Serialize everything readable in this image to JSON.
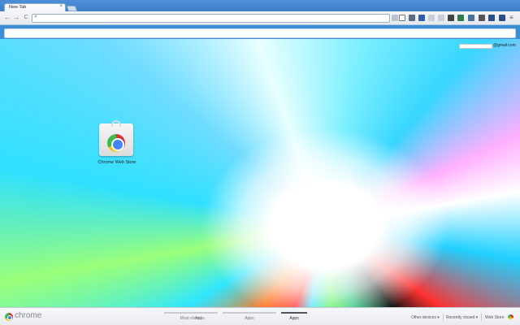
{
  "tab": {
    "title": "New Tab",
    "close": "×"
  },
  "nav": {
    "back": "←",
    "forward": "→",
    "reload": "C"
  },
  "omnibox": {
    "value": "",
    "placeholder": ""
  },
  "user": {
    "email": "@gmail.com"
  },
  "apps": [
    {
      "label": "Chrome Web Store"
    }
  ],
  "footer": {
    "brand": "chrome",
    "pages": [
      "Most visited",
      "Apps",
      "Apps",
      "Apps"
    ],
    "other_devices": "Other devices ▾",
    "recently_closed": "Recently closed ▾",
    "web_store": "Web Store"
  },
  "colors": {
    "titlebar": "#3f7fc8",
    "toolbar": "#e6eaf0"
  }
}
